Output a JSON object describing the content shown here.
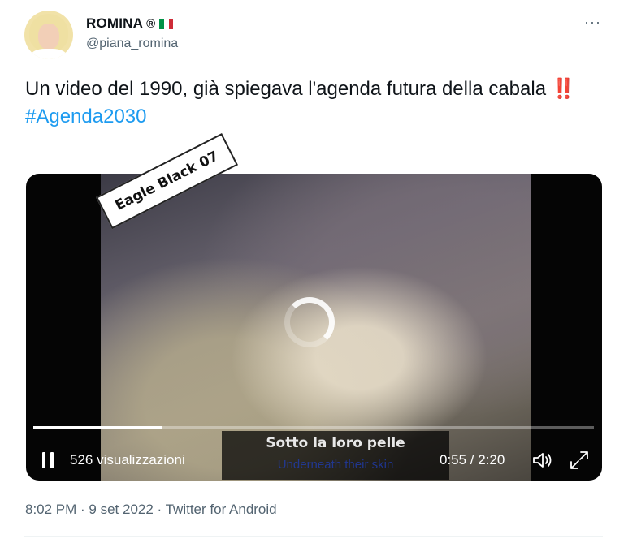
{
  "author": {
    "display_name": "ROMINA",
    "registered_mark": "®",
    "flag_colors": [
      "#009246",
      "#ffffff",
      "#ce2b37"
    ],
    "handle": "@piana_romina",
    "more_label": "···"
  },
  "tweet": {
    "text": "Un video del 1990, già spiegava l'agenda futura della cabala",
    "emoji": "‼️",
    "hashtag": "#Agenda2030"
  },
  "video": {
    "stamp_text": "Eagle Black 07",
    "subtitle_main": "Sotto la loro pelle",
    "subtitle_sub": "Underneath their skin",
    "views": "526 visualizzazioni",
    "time": "0:55 / 2:20",
    "progress_fraction": 0.23,
    "controls": {
      "pause_icon": "pause-icon",
      "volume_icon": "volume-icon",
      "fullscreen_icon": "fullscreen-icon"
    }
  },
  "meta": {
    "timestamp": "8:02 PM · 9 set 2022 · Twitter for Android"
  },
  "colors": {
    "hashtag": "#1d9bf0",
    "secondary_text": "#536471",
    "alert": "#be1931"
  }
}
